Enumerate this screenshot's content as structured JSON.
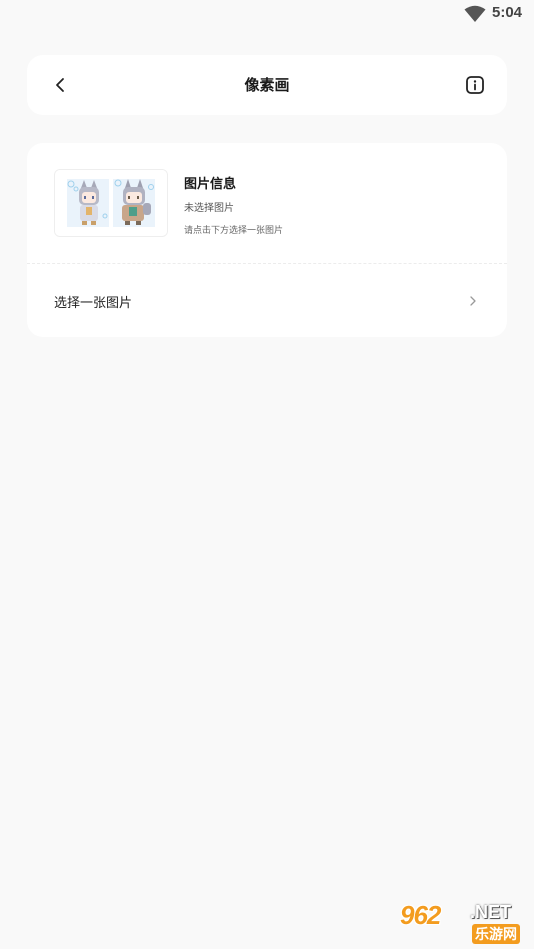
{
  "status_bar": {
    "time": "5:04",
    "wifi_icon": "wifi-icon"
  },
  "header": {
    "title": "像素画",
    "back_icon": "chevron-left-icon",
    "info_icon": "info-icon"
  },
  "image_info": {
    "title": "图片信息",
    "status": "未选择图片",
    "hint": "请点击下方选择一张图片",
    "thumbnail": "pixel-art-sample-thumbnail"
  },
  "select_row": {
    "label": "选择一张图片",
    "chevron_icon": "chevron-right-icon"
  },
  "watermark": {
    "number": "962",
    "domain": ".NET",
    "cn_text": "乐游网",
    "colors": {
      "orange": "#f39c1f"
    }
  },
  "colors": {
    "background": "#f9f9f9",
    "card": "#ffffff",
    "text_primary": "#1a1a1a"
  }
}
